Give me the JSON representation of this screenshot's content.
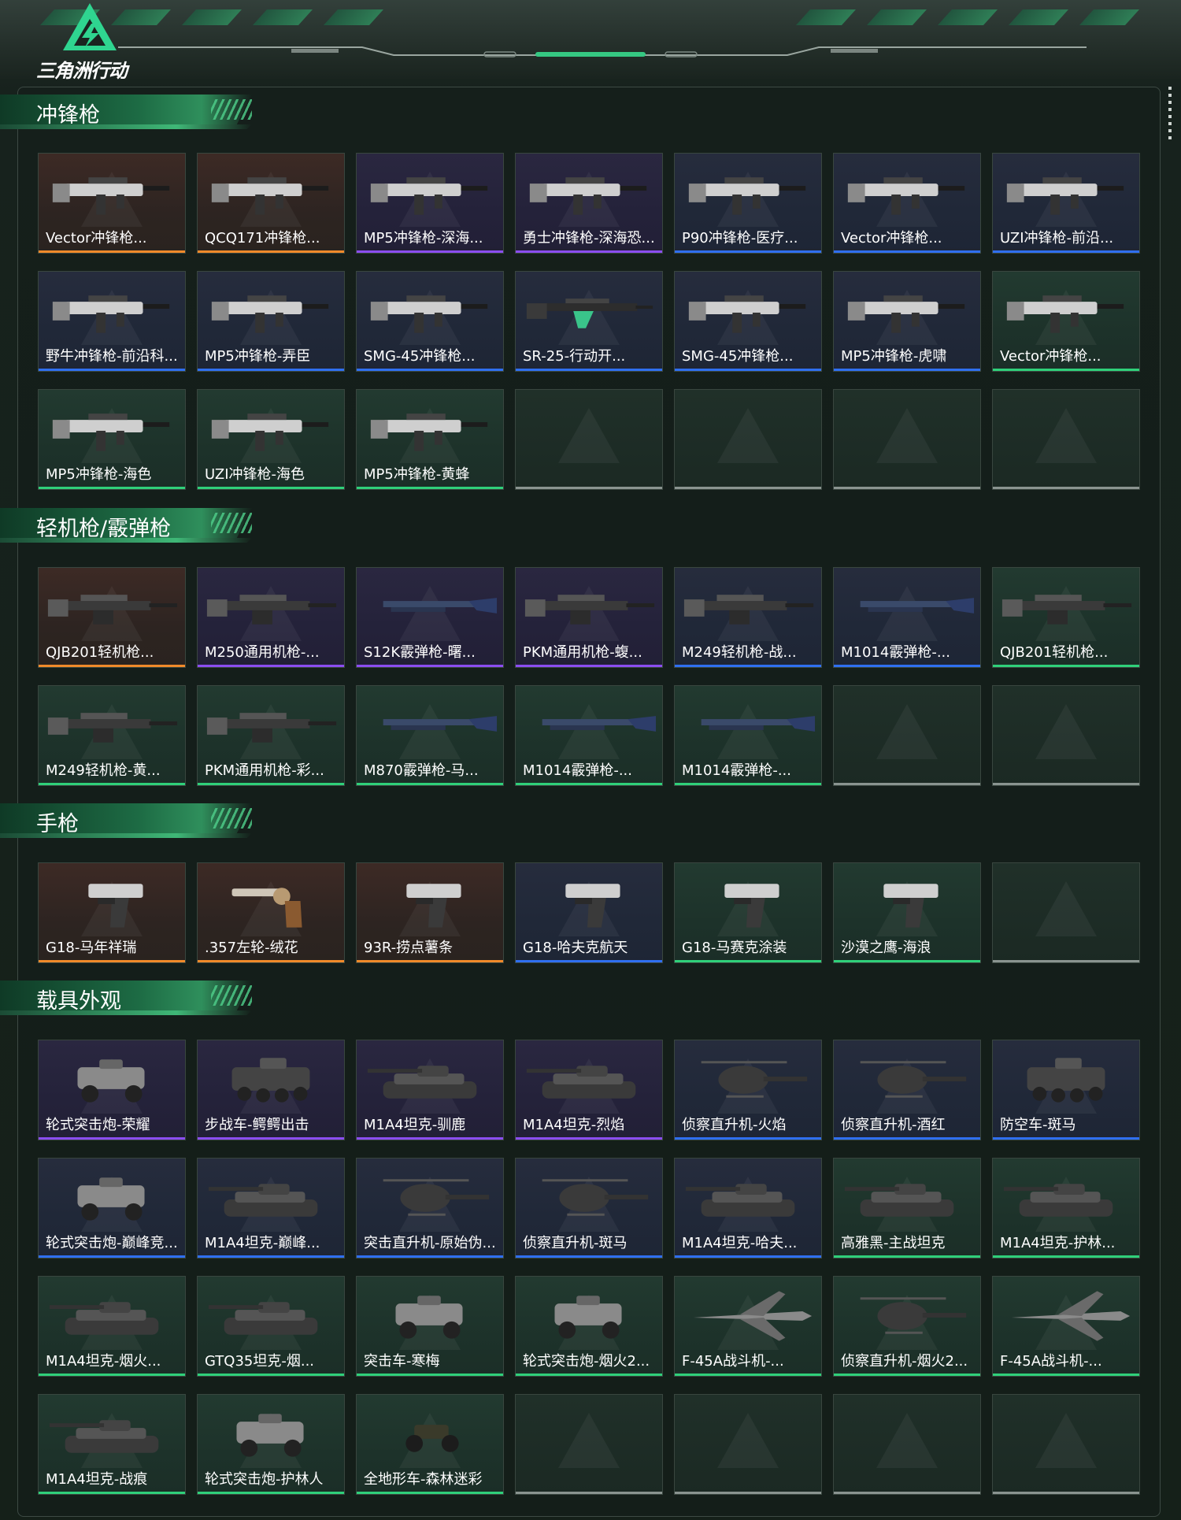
{
  "brand": {
    "logo_text": "三角洲行动",
    "accent": "#2fd07a"
  },
  "rarity_colors": {
    "orange": "#f08a2a",
    "purple": "#8b4df0",
    "blue": "#2f6ff0",
    "green": "#2fd07a",
    "empty": "#8a9490"
  },
  "sections": [
    {
      "title": "冲锋枪",
      "items": [
        {
          "label": "Vector冲锋枪...",
          "rarity": "orange",
          "icon": "smg-icon"
        },
        {
          "label": "QCQ171冲锋枪...",
          "rarity": "orange",
          "icon": "smg-icon"
        },
        {
          "label": "MP5冲锋枪-深海...",
          "rarity": "purple",
          "icon": "smg-icon"
        },
        {
          "label": "勇士冲锋枪-深海恐...",
          "rarity": "purple",
          "icon": "smg-icon"
        },
        {
          "label": "P90冲锋枪-医疗...",
          "rarity": "blue",
          "icon": "smg-icon"
        },
        {
          "label": "Vector冲锋枪...",
          "rarity": "blue",
          "icon": "smg-icon"
        },
        {
          "label": "UZI冲锋枪-前沿...",
          "rarity": "blue",
          "icon": "smg-icon"
        },
        {
          "label": "野牛冲锋枪-前沿科...",
          "rarity": "blue",
          "icon": "smg-icon"
        },
        {
          "label": "MP5冲锋枪-弄臣",
          "rarity": "blue",
          "icon": "smg-icon"
        },
        {
          "label": "SMG-45冲锋枪...",
          "rarity": "blue",
          "icon": "smg-icon"
        },
        {
          "label": "SR-25-行动开...",
          "rarity": "blue",
          "icon": "rifle-icon"
        },
        {
          "label": "SMG-45冲锋枪...",
          "rarity": "blue",
          "icon": "smg-icon"
        },
        {
          "label": "MP5冲锋枪-虎啸",
          "rarity": "blue",
          "icon": "smg-icon"
        },
        {
          "label": "Vector冲锋枪...",
          "rarity": "green",
          "icon": "smg-icon"
        },
        {
          "label": "MP5冲锋枪-海色",
          "rarity": "green",
          "icon": "smg-icon"
        },
        {
          "label": "UZI冲锋枪-海色",
          "rarity": "green",
          "icon": "smg-icon"
        },
        {
          "label": "MP5冲锋枪-黄蜂",
          "rarity": "green",
          "icon": "smg-icon"
        },
        {
          "label": "",
          "rarity": "empty",
          "icon": ""
        },
        {
          "label": "",
          "rarity": "empty",
          "icon": ""
        },
        {
          "label": "",
          "rarity": "empty",
          "icon": ""
        },
        {
          "label": "",
          "rarity": "empty",
          "icon": ""
        }
      ]
    },
    {
      "title": "轻机枪/霰弹枪",
      "items": [
        {
          "label": "QJB201轻机枪...",
          "rarity": "orange",
          "icon": "lmg-icon"
        },
        {
          "label": "M250通用机枪-...",
          "rarity": "purple",
          "icon": "lmg-icon"
        },
        {
          "label": "S12K霰弹枪-曙...",
          "rarity": "purple",
          "icon": "shotgun-icon"
        },
        {
          "label": "PKM通用机枪-蝮...",
          "rarity": "purple",
          "icon": "lmg-icon"
        },
        {
          "label": "M249轻机枪-战...",
          "rarity": "blue",
          "icon": "lmg-icon"
        },
        {
          "label": "M1014霰弹枪-...",
          "rarity": "blue",
          "icon": "shotgun-icon"
        },
        {
          "label": "QJB201轻机枪...",
          "rarity": "green",
          "icon": "lmg-icon"
        },
        {
          "label": "M249轻机枪-黄...",
          "rarity": "green",
          "icon": "lmg-icon"
        },
        {
          "label": "PKM通用机枪-彩...",
          "rarity": "green",
          "icon": "lmg-icon"
        },
        {
          "label": "M870霰弹枪-马...",
          "rarity": "green",
          "icon": "shotgun-icon"
        },
        {
          "label": "M1014霰弹枪-...",
          "rarity": "green",
          "icon": "shotgun-icon"
        },
        {
          "label": "M1014霰弹枪-...",
          "rarity": "green",
          "icon": "shotgun-icon"
        },
        {
          "label": "",
          "rarity": "empty",
          "icon": ""
        },
        {
          "label": "",
          "rarity": "empty",
          "icon": ""
        }
      ]
    },
    {
      "title": "手枪",
      "items": [
        {
          "label": "G18-马年祥瑞",
          "rarity": "orange",
          "icon": "pistol-icon"
        },
        {
          "label": ".357左轮-绒花",
          "rarity": "orange",
          "icon": "revolver-icon"
        },
        {
          "label": "93R-捞点薯条",
          "rarity": "orange",
          "icon": "pistol-icon"
        },
        {
          "label": "G18-哈夫克航天",
          "rarity": "blue",
          "icon": "pistol-icon"
        },
        {
          "label": "G18-马赛克涂装",
          "rarity": "green",
          "icon": "pistol-icon"
        },
        {
          "label": "沙漠之鹰-海浪",
          "rarity": "green",
          "icon": "pistol-icon"
        },
        {
          "label": "",
          "rarity": "empty",
          "icon": ""
        }
      ]
    },
    {
      "title": "载具外观",
      "items": [
        {
          "label": "轮式突击炮-荣耀",
          "rarity": "purple",
          "icon": "armored-car-icon"
        },
        {
          "label": "步战车-鳄鳄出击",
          "rarity": "purple",
          "icon": "ifv-icon"
        },
        {
          "label": "M1A4坦克-驯鹿",
          "rarity": "purple",
          "icon": "tank-icon"
        },
        {
          "label": "M1A4坦克-烈焰",
          "rarity": "purple",
          "icon": "tank-icon"
        },
        {
          "label": "侦察直升机-火焰",
          "rarity": "blue",
          "icon": "helicopter-icon"
        },
        {
          "label": "侦察直升机-酒红",
          "rarity": "blue",
          "icon": "helicopter-icon"
        },
        {
          "label": "防空车-斑马",
          "rarity": "blue",
          "icon": "ifv-icon"
        },
        {
          "label": "轮式突击炮-巅峰竞...",
          "rarity": "blue",
          "icon": "armored-car-icon"
        },
        {
          "label": "M1A4坦克-巅峰...",
          "rarity": "blue",
          "icon": "tank-icon"
        },
        {
          "label": "突击直升机-原始伪...",
          "rarity": "blue",
          "icon": "helicopter-icon"
        },
        {
          "label": "侦察直升机-斑马",
          "rarity": "blue",
          "icon": "helicopter-icon"
        },
        {
          "label": "M1A4坦克-哈夫...",
          "rarity": "blue",
          "icon": "tank-icon"
        },
        {
          "label": "高雅黑-主战坦克",
          "rarity": "green",
          "icon": "tank-icon"
        },
        {
          "label": "M1A4坦克-护林...",
          "rarity": "green",
          "icon": "tank-icon"
        },
        {
          "label": "M1A4坦克-烟火...",
          "rarity": "green",
          "icon": "tank-icon"
        },
        {
          "label": "GTQ35坦克-烟...",
          "rarity": "green",
          "icon": "tank-icon"
        },
        {
          "label": "突击车-寒梅",
          "rarity": "green",
          "icon": "armored-car-icon"
        },
        {
          "label": "轮式突击炮-烟火2...",
          "rarity": "green",
          "icon": "armored-car-icon"
        },
        {
          "label": "F-45A战斗机-...",
          "rarity": "green",
          "icon": "jet-icon"
        },
        {
          "label": "侦察直升机-烟火2...",
          "rarity": "green",
          "icon": "helicopter-icon"
        },
        {
          "label": "F-45A战斗机-...",
          "rarity": "green",
          "icon": "jet-icon"
        },
        {
          "label": "M1A4坦克-战痕",
          "rarity": "green",
          "icon": "tank-icon"
        },
        {
          "label": "轮式突击炮-护林人",
          "rarity": "green",
          "icon": "armored-car-icon"
        },
        {
          "label": "全地形车-森林迷彩",
          "rarity": "green",
          "icon": "atv-icon"
        },
        {
          "label": "",
          "rarity": "empty",
          "icon": ""
        },
        {
          "label": "",
          "rarity": "empty",
          "icon": ""
        },
        {
          "label": "",
          "rarity": "empty",
          "icon": ""
        },
        {
          "label": "",
          "rarity": "empty",
          "icon": ""
        }
      ]
    }
  ]
}
